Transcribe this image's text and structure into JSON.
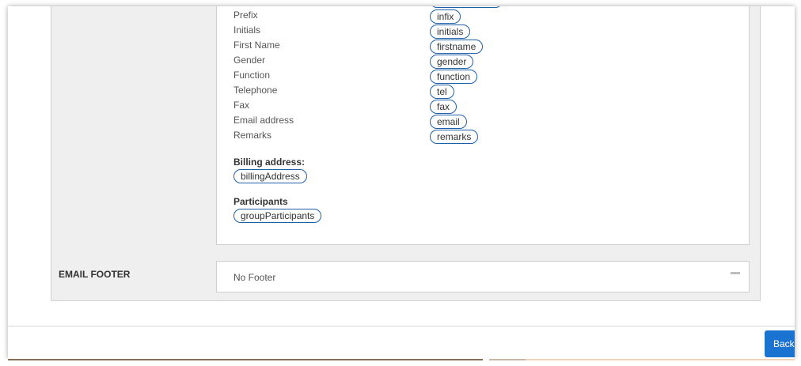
{
  "fields": [
    {
      "label": "Prefix",
      "tag": "infix"
    },
    {
      "label": "Initials",
      "tag": "initials"
    },
    {
      "label": "First Name",
      "tag": "firstname"
    },
    {
      "label": "Gender",
      "tag": "gender"
    },
    {
      "label": "Function",
      "tag": "function"
    },
    {
      "label": "Telephone",
      "tag": "tel"
    },
    {
      "label": "Fax",
      "tag": "fax"
    },
    {
      "label": "Email address",
      "tag": "email"
    },
    {
      "label": "Remarks",
      "tag": "remarks"
    }
  ],
  "billing": {
    "title": "Billing address:",
    "tag": "billingAddress"
  },
  "participants": {
    "title": "Participants",
    "tag": "groupParticipants"
  },
  "email_footer": {
    "label": "EMAIL FOOTER",
    "value": "No Footer"
  },
  "footer": {
    "back_label": "Back"
  }
}
